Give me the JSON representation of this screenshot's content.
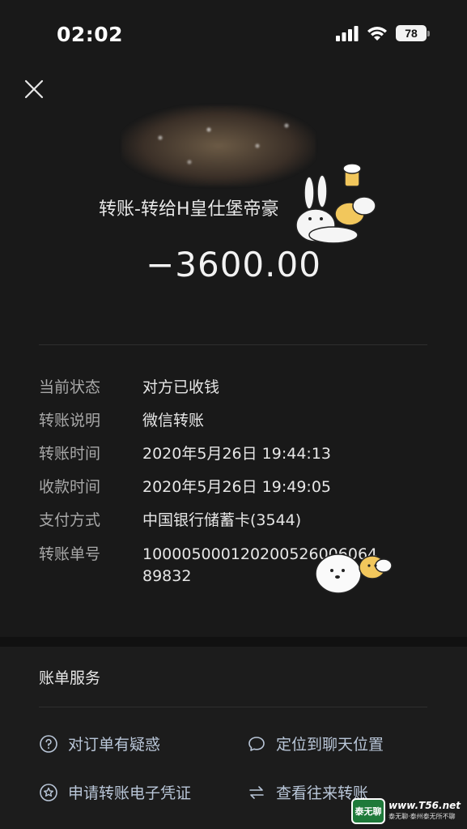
{
  "status_bar": {
    "time": "02:02",
    "battery": "78"
  },
  "header": {
    "title": "转账-转给H皇仕堡帝豪",
    "amount": "−3600.00"
  },
  "details": [
    {
      "label": "当前状态",
      "value": "对方已收钱"
    },
    {
      "label": "转账说明",
      "value": "微信转账"
    },
    {
      "label": "转账时间",
      "value": "2020年5月26日 19:44:13"
    },
    {
      "label": "收款时间",
      "value": "2020年5月26日 19:49:05"
    },
    {
      "label": "支付方式",
      "value": "中国银行储蓄卡(3544)"
    },
    {
      "label": "转账单号",
      "value": "1000050001202005260​06064 89832"
    }
  ],
  "services": {
    "title": "账单服务",
    "items": [
      {
        "label": "对订单有疑惑",
        "icon": "question-circle-icon"
      },
      {
        "label": "定位到聊天位置",
        "icon": "chat-bubble-icon"
      },
      {
        "label": "申请转账电子凭证",
        "icon": "star-circle-icon"
      },
      {
        "label": "查看往来转账",
        "icon": "swap-arrows-icon"
      }
    ]
  },
  "watermark": {
    "logo": "泰无聊",
    "url": "www.T56.net",
    "slogan": "泰无聊·泰州泰无所不聊"
  }
}
